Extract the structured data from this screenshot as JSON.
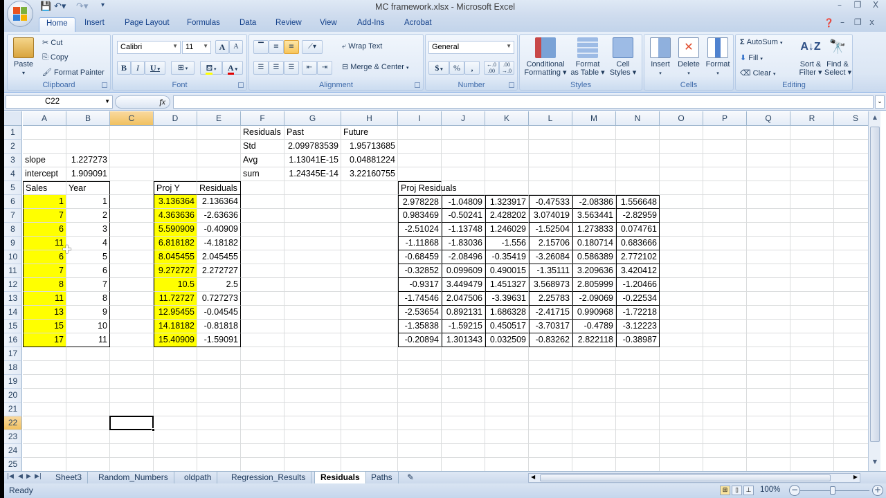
{
  "window": {
    "title": "MC framework.xlsx - Microsoft Excel",
    "controls": {
      "minimize": "–",
      "restore": "❐",
      "close": "X"
    }
  },
  "ribbon_tabs": [
    "Home",
    "Insert",
    "Page Layout",
    "Formulas",
    "Data",
    "Review",
    "View",
    "Add-Ins",
    "Acrobat"
  ],
  "active_tab": "Home",
  "ribbon": {
    "clipboard": {
      "label": "Clipboard",
      "paste": "Paste",
      "cut": "Cut",
      "copy": "Copy",
      "format_painter": "Format Painter"
    },
    "font": {
      "label": "Font",
      "font_name": "Calibri",
      "font_size": "11",
      "bold": "B",
      "italic": "I",
      "underline": "U",
      "grow": "A",
      "shrink": "A",
      "fill_color": "#ffff00",
      "font_color": "#e00000"
    },
    "alignment": {
      "label": "Alignment",
      "wrap_text": "Wrap Text",
      "merge_center": "Merge & Center"
    },
    "number": {
      "label": "Number",
      "format": "General",
      "currency": "$",
      "percent": "%",
      "comma": ",",
      "inc_decimal": "←.0 .00",
      "dec_decimal": ".00 →.0"
    },
    "styles": {
      "label": "Styles",
      "conditional_formatting": [
        "Conditional",
        "Formatting ▾"
      ],
      "format_as_table": [
        "Format",
        "as Table ▾"
      ],
      "cell_styles": [
        "Cell",
        "Styles ▾"
      ]
    },
    "cells": {
      "label": "Cells",
      "insert": "Insert",
      "delete": "Delete",
      "format": "Format"
    },
    "editing": {
      "label": "Editing",
      "autosum": "AutoSum",
      "fill": "Fill",
      "clear": "Clear",
      "sort_filter": [
        "Sort &",
        "Filter ▾"
      ],
      "find_select": [
        "Find &",
        "Select ▾"
      ]
    }
  },
  "formula_bar": {
    "name_box": "C22",
    "fx": "fx",
    "formula": ""
  },
  "columns": [
    "A",
    "B",
    "C",
    "D",
    "E",
    "F",
    "G",
    "H",
    "I",
    "J",
    "K",
    "L",
    "M",
    "N",
    "O",
    "P",
    "Q",
    "R",
    "S"
  ],
  "rows": [
    "1",
    "2",
    "3",
    "4",
    "5",
    "6",
    "7",
    "8",
    "9",
    "10",
    "11",
    "12",
    "13",
    "14",
    "15",
    "16",
    "17",
    "18",
    "19",
    "20",
    "21",
    "22",
    "23",
    "24",
    "25"
  ],
  "selected_cell": {
    "col": "C",
    "row": "22"
  },
  "cells": {
    "regression": {
      "slope_label": "slope",
      "slope": "1.227273",
      "intercept_label": "intercept",
      "intercept": "1.909091"
    },
    "sales_table": {
      "headers": [
        "Sales",
        "Year"
      ],
      "sales": [
        "1",
        "7",
        "6",
        "11",
        "6",
        "7",
        "8",
        "11",
        "13",
        "15",
        "17"
      ],
      "year": [
        "1",
        "2",
        "3",
        "4",
        "5",
        "6",
        "7",
        "8",
        "9",
        "10",
        "11"
      ]
    },
    "proj_table": {
      "headers": [
        "Proj Y",
        "Residuals"
      ],
      "proj_y": [
        "3.136364",
        "4.363636",
        "5.590909",
        "6.818182",
        "8.045455",
        "9.272727",
        "10.5",
        "11.72727",
        "12.95455",
        "14.18182",
        "15.40909"
      ],
      "residuals": [
        "2.136364",
        "-2.63636",
        "-0.40909",
        "-4.18182",
        "2.045455",
        "2.272727",
        "2.5",
        "0.727273",
        "-0.04545",
        "-0.81818",
        "-1.59091"
      ]
    },
    "summary": {
      "header": [
        "Residuals",
        "Past",
        "Future"
      ],
      "rows": [
        [
          "Std",
          "2.099783539",
          "1.95713685"
        ],
        [
          "Avg",
          "1.13041E-15",
          "0.04881224"
        ],
        [
          "sum",
          "1.24345E-14",
          "3.22160755"
        ]
      ]
    },
    "proj_residuals": {
      "title": "Proj Residuals",
      "rows": [
        [
          "2.978228",
          "-1.04809",
          "1.323917",
          "-0.47533",
          "-2.08386",
          "1.556648"
        ],
        [
          "0.983469",
          "-0.50241",
          "2.428202",
          "3.074019",
          "3.563441",
          "-2.82959"
        ],
        [
          "-2.51024",
          "-1.13748",
          "1.246029",
          "-1.52504",
          "1.273833",
          "0.074761"
        ],
        [
          "-1.11868",
          "-1.83036",
          "-1.556",
          "2.15706",
          "0.180714",
          "0.683666"
        ],
        [
          "-0.68459",
          "-2.08496",
          "-0.35419",
          "-3.26084",
          "0.586389",
          "2.772102"
        ],
        [
          "-0.32852",
          "0.099609",
          "0.490015",
          "-1.35111",
          "3.209636",
          "3.420412"
        ],
        [
          "-0.9317",
          "3.449479",
          "1.451327",
          "3.568973",
          "2.805999",
          "-1.20466"
        ],
        [
          "-1.74546",
          "2.047506",
          "-3.39631",
          "2.25783",
          "-2.09069",
          "-0.22534"
        ],
        [
          "-2.53654",
          "0.892131",
          "1.686328",
          "-2.41715",
          "0.990968",
          "-1.72218"
        ],
        [
          "-1.35838",
          "-1.59215",
          "0.450517",
          "-3.70317",
          "-0.4789",
          "-3.12223"
        ],
        [
          "-0.20894",
          "1.301343",
          "0.032509",
          "-0.83262",
          "2.822118",
          "-0.38987"
        ]
      ]
    }
  },
  "sheet_tabs": [
    "Sheet3",
    "Random_Numbers",
    "oldpath",
    "Regression_Results",
    "Residuals",
    "Paths"
  ],
  "active_sheet": "Residuals",
  "status": {
    "text": "Ready",
    "zoom": "100%"
  },
  "colors": {
    "highlight": "#ffff00",
    "selected_header": "#f4c96e",
    "ribbon": "#dbe6f4"
  }
}
